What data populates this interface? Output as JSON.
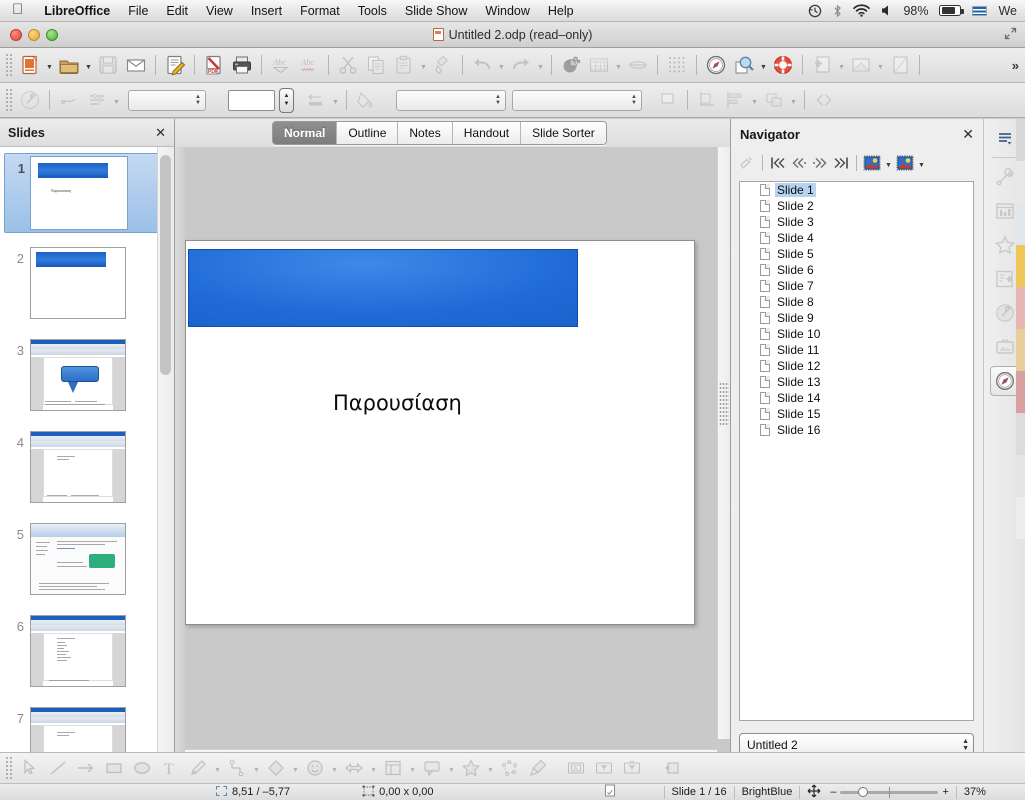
{
  "macbar": {
    "apple_icon": "apple-icon",
    "app_name": "LibreOffice",
    "menus": [
      "File",
      "Edit",
      "View",
      "Insert",
      "Format",
      "Tools",
      "Slide Show",
      "Window",
      "Help"
    ],
    "status_items": [
      {
        "name": "time-machine-icon",
        "glyph": "◴"
      },
      {
        "name": "bluetooth-icon",
        "glyph": "✶"
      },
      {
        "name": "wifi-icon",
        "glyph": "◠"
      },
      {
        "name": "volume-icon",
        "glyph": "◀"
      }
    ],
    "battery_percent": "98%",
    "input_language": "We"
  },
  "window": {
    "title": "Untitled 2.odp (read–only)",
    "doc_icon": "impress-document-icon",
    "traffic_lights": [
      "close-button",
      "minimize-button",
      "zoom-button"
    ],
    "fullscreen_icon": "fullscreen-icon"
  },
  "toolbar_main": {
    "items": [
      {
        "name": "new-document-button",
        "icon": "new-doc-icon",
        "dim": false,
        "caret": true
      },
      {
        "name": "open-document-button",
        "icon": "open-folder-icon",
        "dim": false,
        "caret": true
      },
      {
        "name": "save-button",
        "icon": "save-floppy-icon",
        "dim": true,
        "caret": false
      },
      {
        "name": "email-button",
        "icon": "envelope-icon",
        "dim": false,
        "caret": false
      },
      {
        "sep": true
      },
      {
        "name": "edit-mode-button",
        "icon": "edit-pencil-icon",
        "dim": false,
        "caret": false
      },
      {
        "sep": true
      },
      {
        "name": "export-pdf-button",
        "icon": "pdf-icon",
        "dim": false,
        "caret": false
      },
      {
        "name": "print-button",
        "icon": "printer-icon",
        "dim": false,
        "caret": false
      },
      {
        "sep": true
      },
      {
        "name": "print-preview-button",
        "icon": "abc-preview-icon",
        "dim": true,
        "caret": false
      },
      {
        "name": "spelling-button",
        "icon": "abc-spellcheck-icon",
        "dim": true,
        "caret": false
      },
      {
        "sep": true
      },
      {
        "name": "cut-button",
        "icon": "scissors-icon",
        "dim": true,
        "caret": false
      },
      {
        "name": "copy-button",
        "icon": "copy-icon",
        "dim": true,
        "caret": false
      },
      {
        "name": "paste-button",
        "icon": "clipboard-icon",
        "dim": true,
        "caret": true
      },
      {
        "name": "clone-formatting-button",
        "icon": "paintbrush-icon",
        "dim": true,
        "caret": false
      },
      {
        "sep": true
      },
      {
        "name": "undo-button",
        "icon": "undo-arrow-icon",
        "dim": true,
        "caret": true
      },
      {
        "name": "redo-button",
        "icon": "redo-arrow-icon",
        "dim": true,
        "caret": true
      },
      {
        "sep": true
      },
      {
        "name": "chart-button",
        "icon": "chart-pie-icon",
        "dim": false,
        "caret": false
      },
      {
        "name": "table-button",
        "icon": "table-grid-icon",
        "dim": true,
        "caret": true
      },
      {
        "name": "display-grid-button",
        "icon": "grid-snap-icon",
        "dim": true,
        "caret": false
      },
      {
        "sep": true
      },
      {
        "name": "grid-visible-button",
        "icon": "dot-grid-icon",
        "dim": true,
        "caret": false
      },
      {
        "sep": true
      },
      {
        "name": "navigator-button",
        "icon": "compass-icon",
        "dim": false,
        "caret": false
      },
      {
        "name": "zoom-button",
        "icon": "magnifier-icon",
        "dim": false,
        "caret": true
      },
      {
        "name": "help-button",
        "icon": "lifebuoy-icon",
        "dim": false,
        "caret": false
      },
      {
        "sep": true
      },
      {
        "name": "new-slide-button",
        "icon": "new-slide-icon",
        "dim": true,
        "caret": true
      },
      {
        "name": "slide-layout-button",
        "icon": "slide-layout-icon",
        "dim": true,
        "caret": true
      },
      {
        "name": "slide-master-button",
        "icon": "slide-master-icon",
        "dim": true,
        "caret": false
      },
      {
        "sep": true
      }
    ],
    "overflow_label": "»"
  },
  "toolbar_line_fill": {
    "items": [
      {
        "name": "line-properties-button",
        "icon": "wrench-circle-icon",
        "dim": true
      },
      {
        "sep": true
      },
      {
        "name": "line-style-button",
        "icon": "line-tool-icon",
        "dim": true
      },
      {
        "name": "line-settings-button",
        "icon": "line-settings-icon",
        "dim": true,
        "caret": true
      }
    ],
    "line_style_value": "",
    "line_width_value": "",
    "line_color_swatch": "#ffffff",
    "arrow_style_name": "arrow-style-button",
    "fill_style_name": "fill-style-button",
    "area_style_value": "",
    "area_fill_value": "",
    "shadow_name": "shadow-button",
    "align_name": "align-objects-button",
    "arrange_name": "arrange-objects-button",
    "points_name": "edit-points-button"
  },
  "view_tabs": {
    "items": [
      "Normal",
      "Outline",
      "Notes",
      "Handout",
      "Slide Sorter"
    ],
    "active": "Normal"
  },
  "slides_panel": {
    "title": "Slides",
    "close_icon": "close-icon",
    "selected_index": 1,
    "thumbnails": [
      {
        "number": "1",
        "kind": "title",
        "title_text": "Παρουσίαση"
      },
      {
        "number": "2",
        "kind": "band"
      },
      {
        "number": "3",
        "kind": "screenshot-bubble"
      },
      {
        "number": "4",
        "kind": "screenshot-doc"
      },
      {
        "number": "5",
        "kind": "screenshot-web"
      },
      {
        "number": "6",
        "kind": "screenshot-list"
      },
      {
        "number": "7",
        "kind": "screenshot-doc"
      }
    ]
  },
  "canvas": {
    "slide_title": "Παρουσίαση",
    "band_color": "#1f6ad6"
  },
  "navigator": {
    "title": "Navigator",
    "close_icon": "close-icon",
    "tools": [
      {
        "name": "pointer-toggle-button",
        "icon": "pointer-icon",
        "dim": true
      },
      {
        "sep": true
      },
      {
        "name": "first-slide-button",
        "icon": "first-slide-icon",
        "dim": false
      },
      {
        "name": "previous-slide-button",
        "icon": "previous-slide-icon",
        "dim": false
      },
      {
        "name": "next-slide-button",
        "icon": "next-slide-icon",
        "dim": false
      },
      {
        "name": "last-slide-button",
        "icon": "last-slide-icon",
        "dim": false
      },
      {
        "sep": true
      },
      {
        "name": "drag-mode-button",
        "icon": "drag-mode-icon",
        "dim": false,
        "caret": true
      },
      {
        "name": "shapes-view-button",
        "icon": "shapes-view-icon",
        "dim": false,
        "caret": true
      }
    ],
    "items": [
      "Slide 1",
      "Slide 2",
      "Slide 3",
      "Slide 4",
      "Slide 5",
      "Slide 6",
      "Slide 7",
      "Slide 8",
      "Slide 9",
      "Slide 10",
      "Slide 11",
      "Slide 12",
      "Slide 13",
      "Slide 14",
      "Slide 15",
      "Slide 16"
    ],
    "selected_item": "Slide 1",
    "document_select_value": "Untitled 2"
  },
  "sidebar_rail": {
    "items": [
      {
        "name": "sidebar-settings-icon",
        "icon": "hamburger-icon",
        "state": "normal"
      },
      {
        "divider": true
      },
      {
        "name": "sidebar-properties-icon",
        "icon": "wrench-icon",
        "state": "dim"
      },
      {
        "name": "sidebar-slide-transition-icon",
        "icon": "slide-chart-icon",
        "state": "dim"
      },
      {
        "name": "sidebar-animation-icon",
        "icon": "star-icon",
        "state": "dim"
      },
      {
        "name": "sidebar-master-slides-icon",
        "icon": "master-slides-icon",
        "state": "dim"
      },
      {
        "name": "sidebar-styles-icon",
        "icon": "gear-ball-icon",
        "state": "dim"
      },
      {
        "name": "sidebar-gallery-icon",
        "icon": "gallery-icon",
        "state": "dim"
      },
      {
        "name": "sidebar-navigator-icon",
        "icon": "compass-icon",
        "state": "active"
      }
    ]
  },
  "drawing_toolbar": {
    "items": [
      {
        "name": "select-tool-button",
        "icon": "cursor-arrow-icon",
        "caret": false
      },
      {
        "name": "line-tool-button",
        "icon": "line-icon",
        "caret": false
      },
      {
        "name": "arrow-tool-button",
        "icon": "arrow-right-icon",
        "caret": false
      },
      {
        "name": "rectangle-tool-button",
        "icon": "rectangle-icon",
        "caret": false
      },
      {
        "name": "ellipse-tool-button",
        "icon": "ellipse-icon",
        "caret": false
      },
      {
        "name": "text-tool-button",
        "icon": "text-T-icon",
        "caret": false
      },
      {
        "name": "curve-tool-button",
        "icon": "pencil-curve-icon",
        "caret": true
      },
      {
        "name": "connector-tool-button",
        "icon": "connector-icon",
        "caret": true
      },
      {
        "name": "basic-shapes-button",
        "icon": "diamond-icon",
        "caret": true
      },
      {
        "name": "symbol-shapes-button",
        "icon": "smiley-icon",
        "caret": true
      },
      {
        "name": "block-arrows-button",
        "icon": "double-arrow-icon",
        "caret": true
      },
      {
        "name": "flowchart-shapes-button",
        "icon": "flowchart-icon",
        "caret": true
      },
      {
        "name": "callout-shapes-button",
        "icon": "callout-icon",
        "caret": true
      },
      {
        "name": "stars-shapes-button",
        "icon": "star-shape-icon",
        "caret": true
      },
      {
        "name": "points-button",
        "icon": "edit-points-icon",
        "caret": false
      },
      {
        "name": "glue-points-button",
        "icon": "glue-point-icon",
        "caret": false
      },
      {
        "name": "insert-text-box-button",
        "icon": "text-box-icon",
        "caret": false
      },
      {
        "name": "insert-image-button",
        "icon": "image-icon",
        "caret": false
      },
      {
        "name": "insert-media-button",
        "icon": "media-icon",
        "caret": false
      },
      {
        "name": "rotate-button",
        "icon": "rotate-icon",
        "caret": false
      }
    ]
  },
  "statusbar": {
    "position_icon": "position-icon",
    "position": "8,51 / –5,77",
    "size_icon": "size-icon",
    "size": "0,00 x 0,00",
    "modified_icon": "modified-doc-icon",
    "slide_count": "Slide 1 / 16",
    "master_name": "BrightBlue",
    "fit_icon": "fit-slide-icon",
    "zoom_minus": "–",
    "zoom_plus": "+",
    "zoom_value": "37%"
  }
}
